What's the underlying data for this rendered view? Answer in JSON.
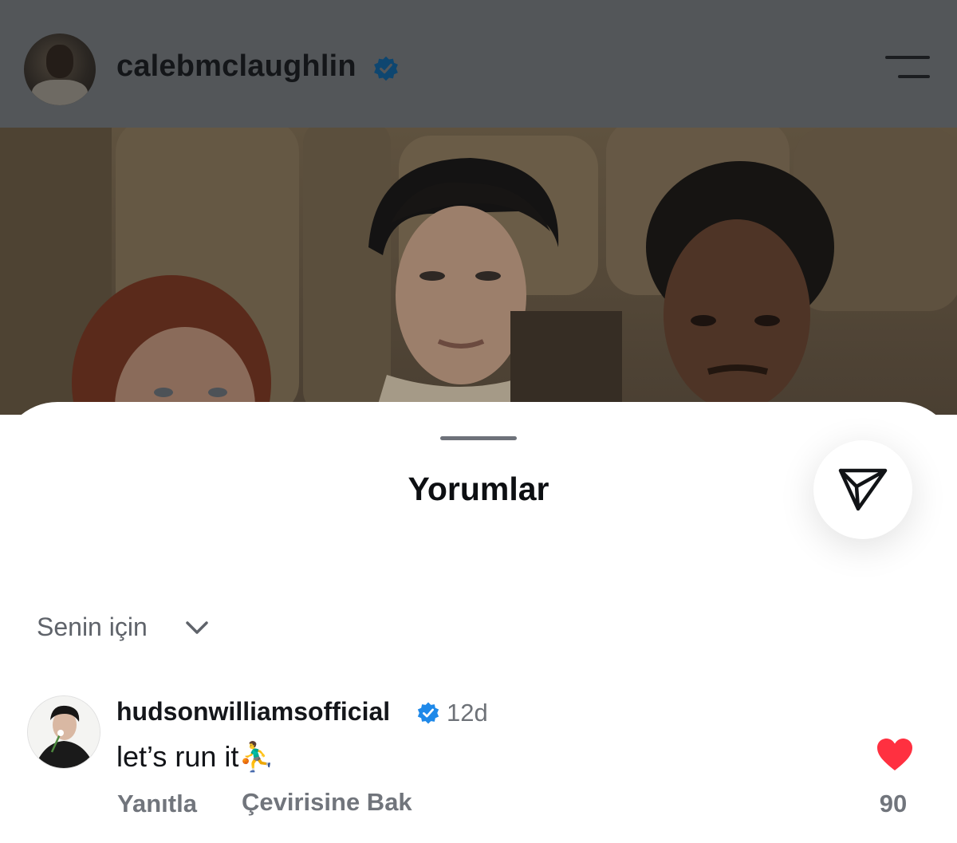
{
  "post": {
    "username": "calebmclaughlin",
    "verified": true,
    "icons": {
      "avatar": "profile-photo",
      "verified": "verified-badge-icon",
      "menu": "hamburger-menu-icon"
    }
  },
  "comments_sheet": {
    "title": "Yorumlar",
    "share_icon": "paper-plane-send-icon",
    "filter": {
      "label": "Senin için",
      "icon": "chevron-down-icon"
    },
    "comments": [
      {
        "username": "hudsonwilliamsofficial",
        "verified": true,
        "time": "12d",
        "text": "let’s run it⛹️‍♂️",
        "reply_label": "Yanıtla",
        "translate_label": "Çevirisine Bak",
        "liked": true,
        "like_count": "90"
      }
    ]
  },
  "colors": {
    "dim_header": "#535659",
    "verified_blue": "#1f89e9",
    "like_red": "#ff3040",
    "secondary_text": "#71757c"
  }
}
